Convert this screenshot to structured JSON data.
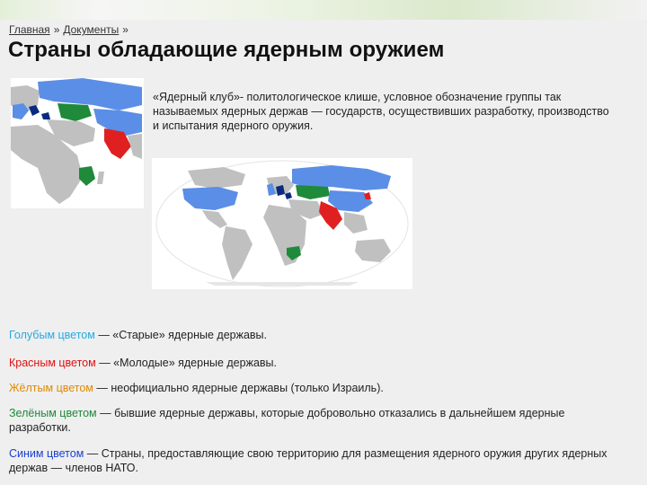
{
  "breadcrumb": {
    "home": "Главная",
    "separator": "»",
    "docs": "Документы",
    "trailing": "»"
  },
  "title": "Страны обладающие ядерным оружием",
  "intro": "«Ядерный клуб»- политологическое клише, условное обозначение группы так называемых  ядерных держав — государств, осуществивших разработку, производство и испытания ядерного оружия.",
  "legend": [
    {
      "colored": "Голубым цветом",
      "rest": " — «Старые» ядерные державы.",
      "color": "#29a8e0"
    },
    {
      "colored": "Красным цветом",
      "rest": " — «Молодые» ядерные державы.",
      "color": "#e01010"
    },
    {
      "colored": "Жёлтым цветом",
      "rest": " — неофициально ядерные державы (только Израиль).",
      "color": "#e08a00"
    },
    {
      "colored": "Зелёным цветом",
      "rest": " — бывшие ядерные державы, которые добровольно отказались в дальнейшем ядерные разработки.",
      "color": "#1e8a3a"
    },
    {
      "colored": "Синим цветом",
      "rest": " — Страны, предоставляющие свою территорию для размещения ядерного оружия других ядерных держав — членов НАТО.",
      "color": "#1a3fd0"
    }
  ],
  "colors": {
    "old_powers": "#5b8ee6",
    "young_powers": "#e02020",
    "former_powers": "#1e8a3a",
    "nato_hosts": "#0a2a80",
    "other_land": "#c0c0c0"
  }
}
